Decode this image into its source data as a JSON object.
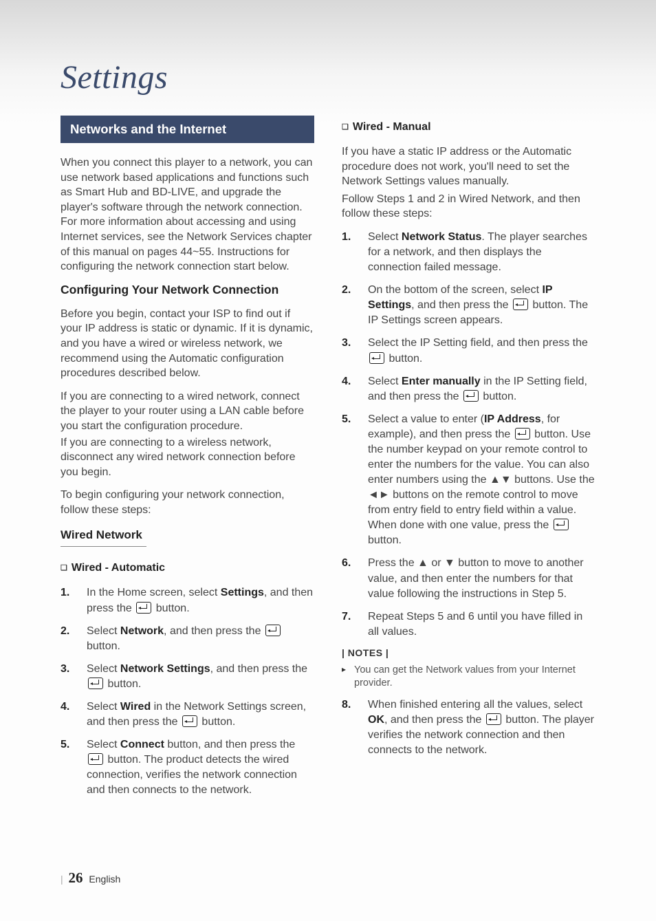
{
  "page_title": "Settings",
  "section_header": "Networks and the Internet",
  "intro": "When you connect this player to a network, you can use network based applications and functions such as Smart Hub and BD-LIVE, and upgrade the player's software through the network connection. For more information about accessing and using Internet services, see the Network Services chapter of this manual on pages 44~55. Instructions for configuring the network connection start below.",
  "configure_heading": "Configuring Your Network Connection",
  "configure_p1": "Before you begin, contact your ISP to find out if your IP address is static or dynamic. If it is dynamic, and you have a wired or wireless network, we recommend using the Automatic configuration procedures described below.",
  "configure_p2a": "If you are connecting to a wired network, connect the player to your router using a LAN cable before you start the configuration procedure.",
  "configure_p2b": "If you are connecting to a wireless network, disconnect any wired network connection before you begin.",
  "configure_p3": "To begin configuring your network connection, follow these steps:",
  "wired_heading": "Wired Network",
  "wired_auto_heading": "Wired - Automatic",
  "wired_auto_steps": {
    "1": {
      "pre": "In the Home screen, select ",
      "bold": "Settings",
      "post": ", and then press the ",
      "after_icon": " button."
    },
    "2": {
      "pre": "Select ",
      "bold": "Network",
      "post": ", and then press the ",
      "after_icon": " button."
    },
    "3": {
      "pre": "Select ",
      "bold": "Network Settings",
      "post": ", and then press the ",
      "after_icon": " button."
    },
    "4": {
      "pre": "Select ",
      "bold": "Wired",
      "post": " in the Network Settings screen, and then press the ",
      "after_icon": " button."
    },
    "5": {
      "pre": "Select ",
      "bold": "Connect",
      "post": " button, and then press the ",
      "after_icon": " button. The product detects the wired connection, verifies the network connection and then connects to the network."
    }
  },
  "wired_manual_heading": "Wired - Manual",
  "wired_manual_intro1": "If you have a static IP address or the Automatic procedure does not work, you'll need to set the Network Settings values manually.",
  "wired_manual_intro2": "Follow Steps 1 and 2 in Wired Network, and then follow these steps:",
  "wired_manual_steps": {
    "1": {
      "pre": "Select ",
      "bold": "Network Status",
      "post": ". The player searches for a network, and then displays the connection failed message."
    },
    "2": {
      "pre": "On the bottom of the screen, select ",
      "bold": "IP Settings",
      "post": ", and then press the ",
      "after_icon": " button. The IP Settings screen appears."
    },
    "3": {
      "pre": "Select the IP Setting field, and then press the ",
      "after_icon": " button."
    },
    "4": {
      "pre": "Select ",
      "bold": "Enter manually",
      "post": " in the IP Setting field, and then press the ",
      "after_icon": " button."
    },
    "5": {
      "pre": "Select a value to enter (",
      "bold": "IP Address",
      "post": ", for example), and then press the ",
      "after_icon": " button. Use the number keypad on your remote control to enter the numbers for the value. You can also enter numbers using the ▲▼ buttons. Use the ◄► buttons on the remote control to move from entry field to entry field within a value. When done with one value, press the ",
      "after_icon2": " button."
    },
    "6": {
      "text": "Press the ▲ or ▼ button to move to another value, and then enter the numbers for that value following the instructions in Step 5."
    },
    "7": {
      "text": "Repeat Steps 5 and 6 until you have filled in all values."
    }
  },
  "notes_label": "| NOTES |",
  "note1": "You can get the Network values from your Internet provider.",
  "step8": {
    "pre": "When finished entering all the values, select ",
    "bold": "OK",
    "post": ", and then press the ",
    "after_icon": " button. The player verifies the network connection and then connects to the network."
  },
  "footer": {
    "page_number": "26",
    "lang": "English"
  }
}
